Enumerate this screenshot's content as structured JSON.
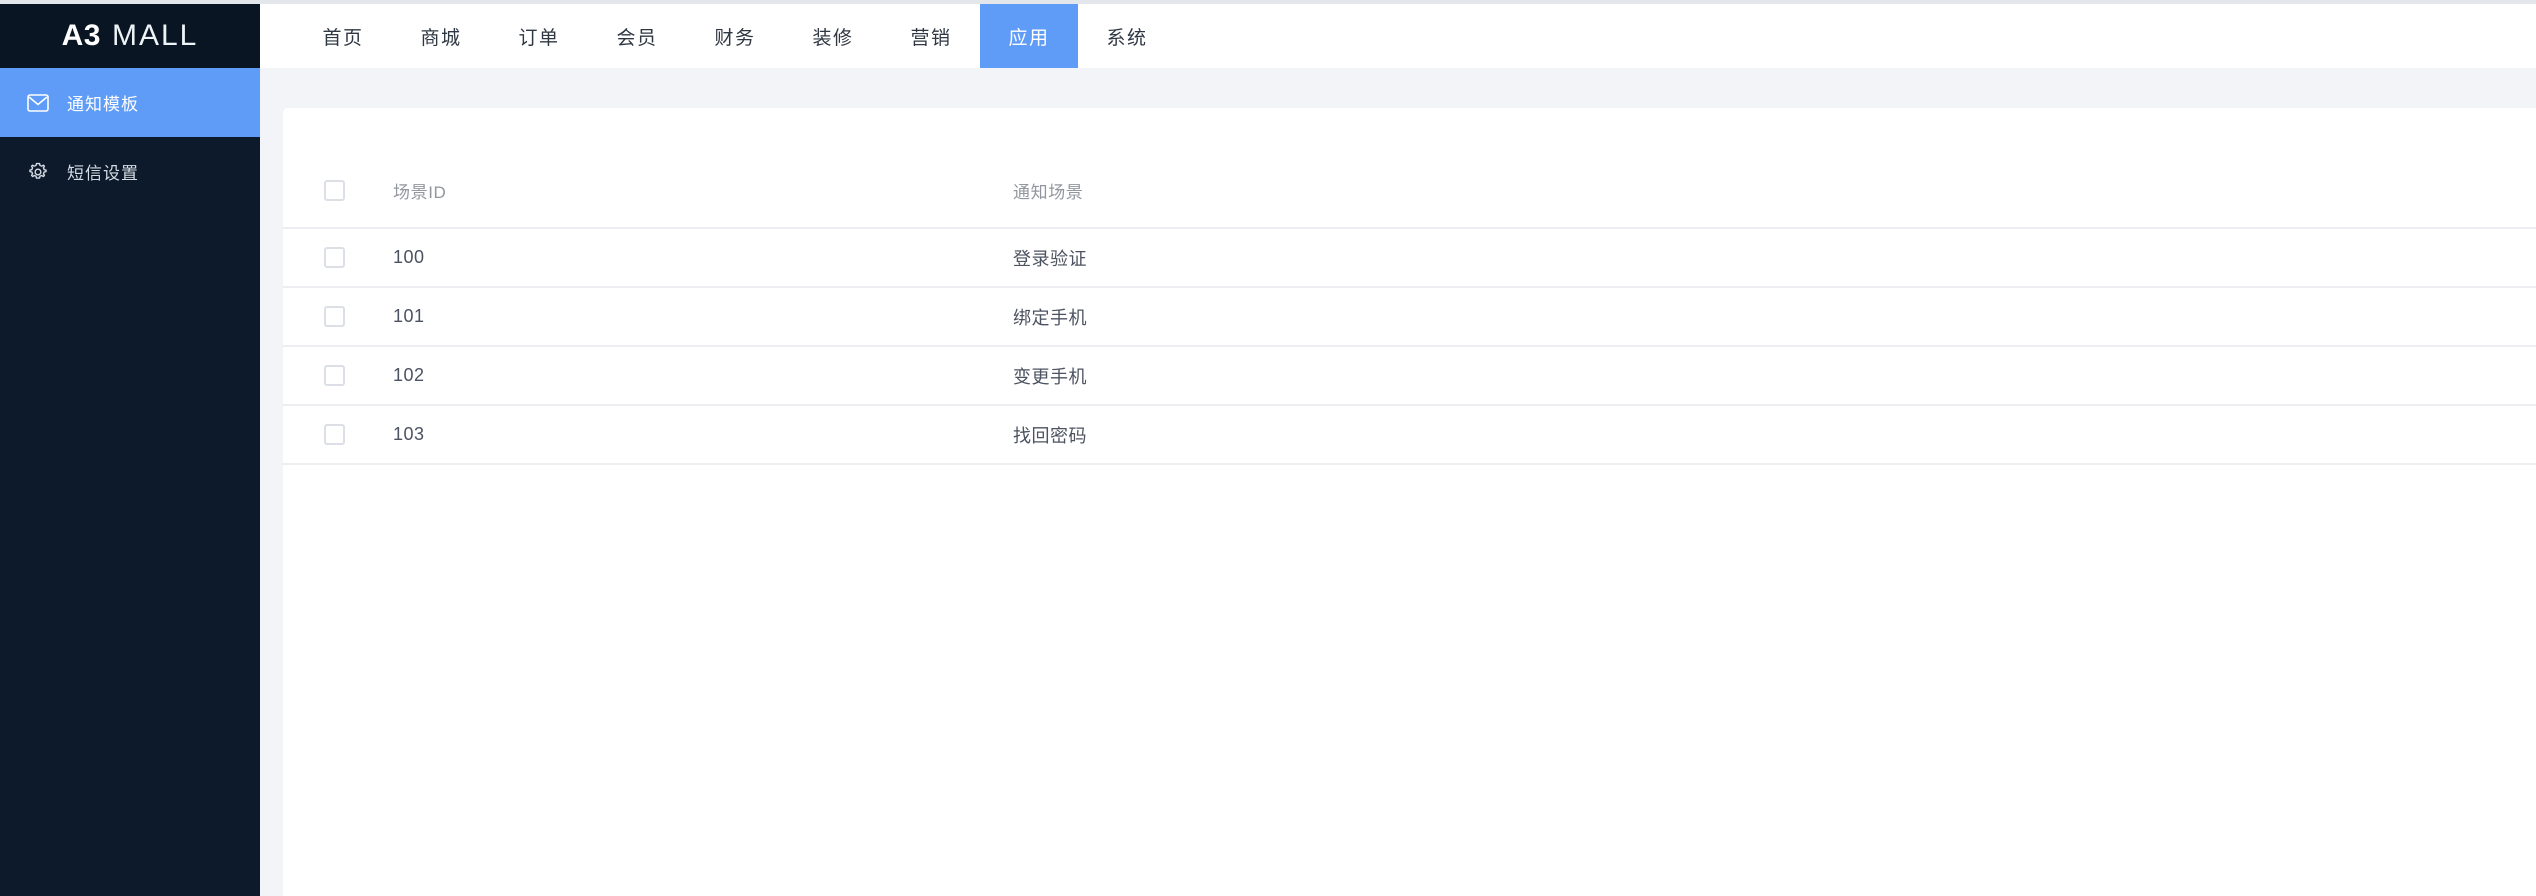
{
  "brand": {
    "name_bold": "A3",
    "name_light": "MALL"
  },
  "sidebar": {
    "items": [
      {
        "label": "通知模板",
        "icon": "mail-icon",
        "active": true
      },
      {
        "label": "短信设置",
        "icon": "gear-icon",
        "active": false
      }
    ]
  },
  "topnav": {
    "items": [
      {
        "label": "首页",
        "active": false
      },
      {
        "label": "商城",
        "active": false
      },
      {
        "label": "订单",
        "active": false
      },
      {
        "label": "会员",
        "active": false
      },
      {
        "label": "财务",
        "active": false
      },
      {
        "label": "装修",
        "active": false
      },
      {
        "label": "营销",
        "active": false
      },
      {
        "label": "应用",
        "active": true
      },
      {
        "label": "系统",
        "active": false
      }
    ]
  },
  "table": {
    "columns": {
      "select": "",
      "scene_id": "场景ID",
      "scene_name": "通知场景"
    },
    "header_checked": false,
    "rows": [
      {
        "checked": false,
        "scene_id": "100",
        "scene_name": "登录验证"
      },
      {
        "checked": false,
        "scene_id": "101",
        "scene_name": "绑定手机"
      },
      {
        "checked": false,
        "scene_id": "102",
        "scene_name": "变更手机"
      },
      {
        "checked": false,
        "scene_id": "103",
        "scene_name": "找回密码"
      }
    ]
  },
  "colors": {
    "accent": "#5f9cf8",
    "sidebar_bg": "#0c1a2b",
    "logo_bg": "#091522",
    "page_bg": "#f2f4f7",
    "card_bg": "#ffffff",
    "row_border": "#eceef2",
    "header_text": "#92969e",
    "body_text": "#4c5260"
  }
}
